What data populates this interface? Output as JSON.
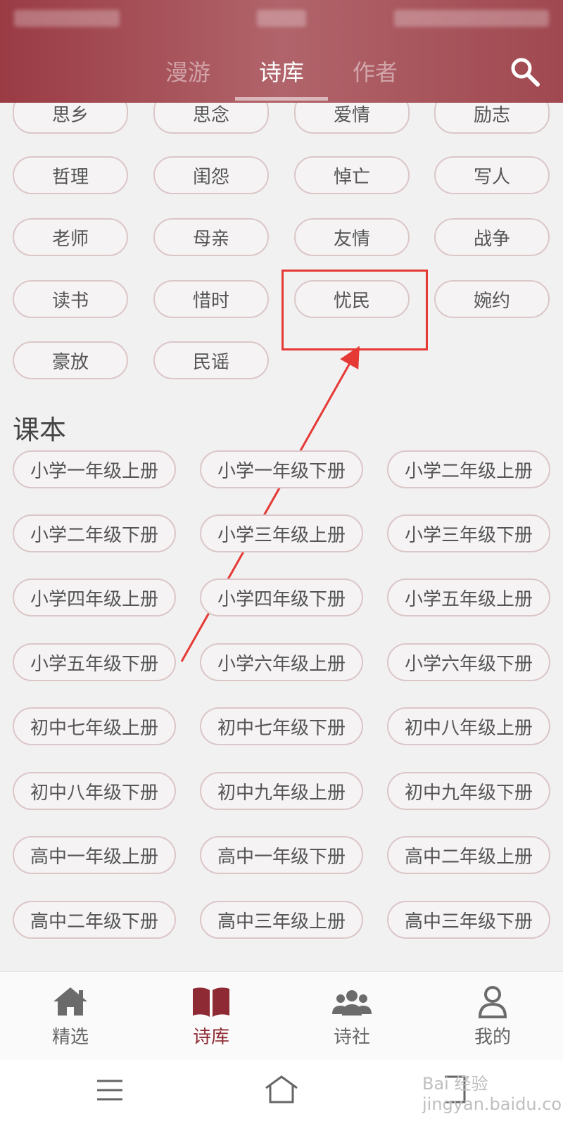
{
  "header": {
    "tabs": [
      {
        "label": "漫游",
        "active": false
      },
      {
        "label": "诗库",
        "active": true
      },
      {
        "label": "作者",
        "active": false
      }
    ]
  },
  "tags_partial": [
    "思乡",
    "思念",
    "爱情",
    "励志"
  ],
  "tags": [
    [
      "哲理",
      "闺怨",
      "悼亡",
      "写人"
    ],
    [
      "老师",
      "母亲",
      "友情",
      "战争"
    ],
    [
      "读书",
      "惜时",
      "忧民",
      "婉约"
    ],
    [
      "豪放",
      "民谣"
    ]
  ],
  "textbook": {
    "title": "课本",
    "items": [
      [
        "小学一年级上册",
        "小学一年级下册",
        "小学二年级上册"
      ],
      [
        "小学二年级下册",
        "小学三年级上册",
        "小学三年级下册"
      ],
      [
        "小学四年级上册",
        "小学四年级下册",
        "小学五年级上册"
      ],
      [
        "小学五年级下册",
        "小学六年级上册",
        "小学六年级下册"
      ],
      [
        "初中七年级上册",
        "初中七年级下册",
        "初中八年级上册"
      ],
      [
        "初中八年级下册",
        "初中九年级上册",
        "初中九年级下册"
      ],
      [
        "高中一年级上册",
        "高中一年级下册",
        "高中二年级上册"
      ],
      [
        "高中二年级下册",
        "高中三年级上册",
        "高中三年级下册"
      ]
    ]
  },
  "bottom_nav": [
    {
      "label": "精选",
      "icon": "home-icon",
      "active": false
    },
    {
      "label": "诗库",
      "icon": "book-icon",
      "active": true
    },
    {
      "label": "诗社",
      "icon": "users-icon",
      "active": false
    },
    {
      "label": "我的",
      "icon": "user-icon",
      "active": false
    }
  ],
  "colors": {
    "accent": "#8e2a33",
    "annotation": "#e53935"
  },
  "watermark": "Bai 经验 jingyan.baidu.com"
}
